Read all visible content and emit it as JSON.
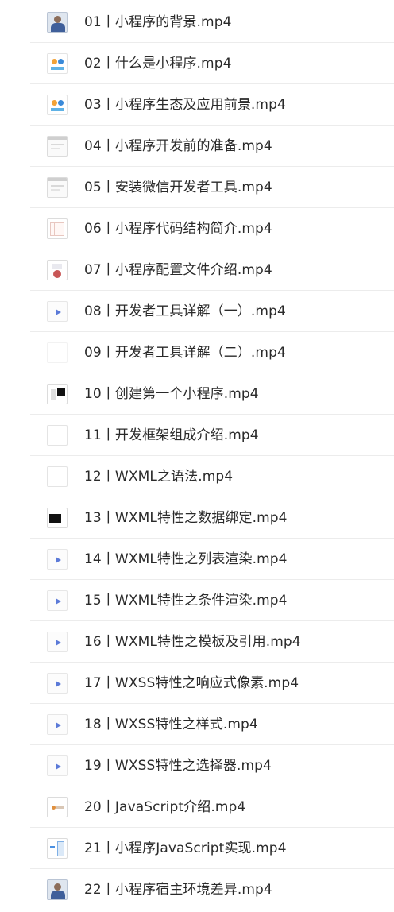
{
  "items": [
    {
      "label": "01丨小程序的背景.mp4",
      "thumb": "person-photo"
    },
    {
      "label": "02丨什么是小程序.mp4",
      "thumb": "colorful-slide"
    },
    {
      "label": "03丨小程序生态及应用前景.mp4",
      "thumb": "colorful-slide"
    },
    {
      "label": "04丨小程序开发前的准备.mp4",
      "thumb": "slide"
    },
    {
      "label": "05丨安装微信开发者工具.mp4",
      "thumb": "slide"
    },
    {
      "label": "06丨小程序代码结构简介.mp4",
      "thumb": "grid-slide"
    },
    {
      "label": "07丨小程序配置文件介绍.mp4",
      "thumb": "red-slide"
    },
    {
      "label": "08丨开发者工具详解（一）.mp4",
      "thumb": "video-play"
    },
    {
      "label": "09丨开发者工具详解（二）.mp4",
      "thumb": "faint-blank"
    },
    {
      "label": "10丨创建第一个小程序.mp4",
      "thumb": "black-slide"
    },
    {
      "label": "11丨开发框架组成介绍.mp4",
      "thumb": "blank"
    },
    {
      "label": "12丨WXML之语法.mp4",
      "thumb": "blank"
    },
    {
      "label": "13丨WXML特性之数据绑定.mp4",
      "thumb": "dark-slide"
    },
    {
      "label": "14丨WXML特性之列表渲染.mp4",
      "thumb": "video-play"
    },
    {
      "label": "15丨WXML特性之条件渲染.mp4",
      "thumb": "video-play"
    },
    {
      "label": "16丨WXML特性之模板及引用.mp4",
      "thumb": "video-play"
    },
    {
      "label": "17丨WXSS特性之响应式像素.mp4",
      "thumb": "video-play"
    },
    {
      "label": "18丨WXSS特性之样式.mp4",
      "thumb": "video-play"
    },
    {
      "label": "19丨WXSS特性之选择器.mp4",
      "thumb": "video-play"
    },
    {
      "label": "20丨JavaScript介绍.mp4",
      "thumb": "logo-slide"
    },
    {
      "label": "21丨小程序JavaScript实现.mp4",
      "thumb": "code-slide"
    },
    {
      "label": "22丨小程序宿主环境差异.mp4",
      "thumb": "person-photo"
    }
  ]
}
